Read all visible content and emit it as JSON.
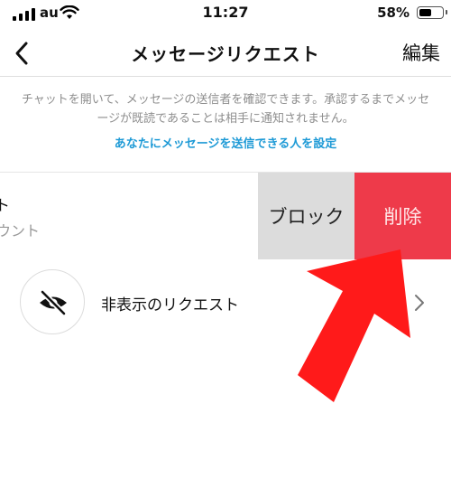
{
  "status": {
    "carrier": "au",
    "time": "11:27",
    "battery": "58%",
    "battery_level": 0.58
  },
  "nav": {
    "title": "メッセージリクエスト",
    "edit_label": "編集"
  },
  "info": {
    "text": "チャットを開いて、メッセージの送信者を確認できます。承認するまでメッセージが既読であることは相手に通知されません。",
    "link": "あなたにメッセージを送信できる人を設定"
  },
  "request": {
    "name_fragment": "ト",
    "sub_fragment": "ウント",
    "block_label": "ブロック",
    "delete_label": "削除"
  },
  "hidden_requests": {
    "label": "非表示のリクエスト"
  },
  "colors": {
    "link": "#1e9ad6",
    "delete": "#ee3a4a",
    "block": "#dcdcdc",
    "arrow": "#ff1a1a"
  }
}
